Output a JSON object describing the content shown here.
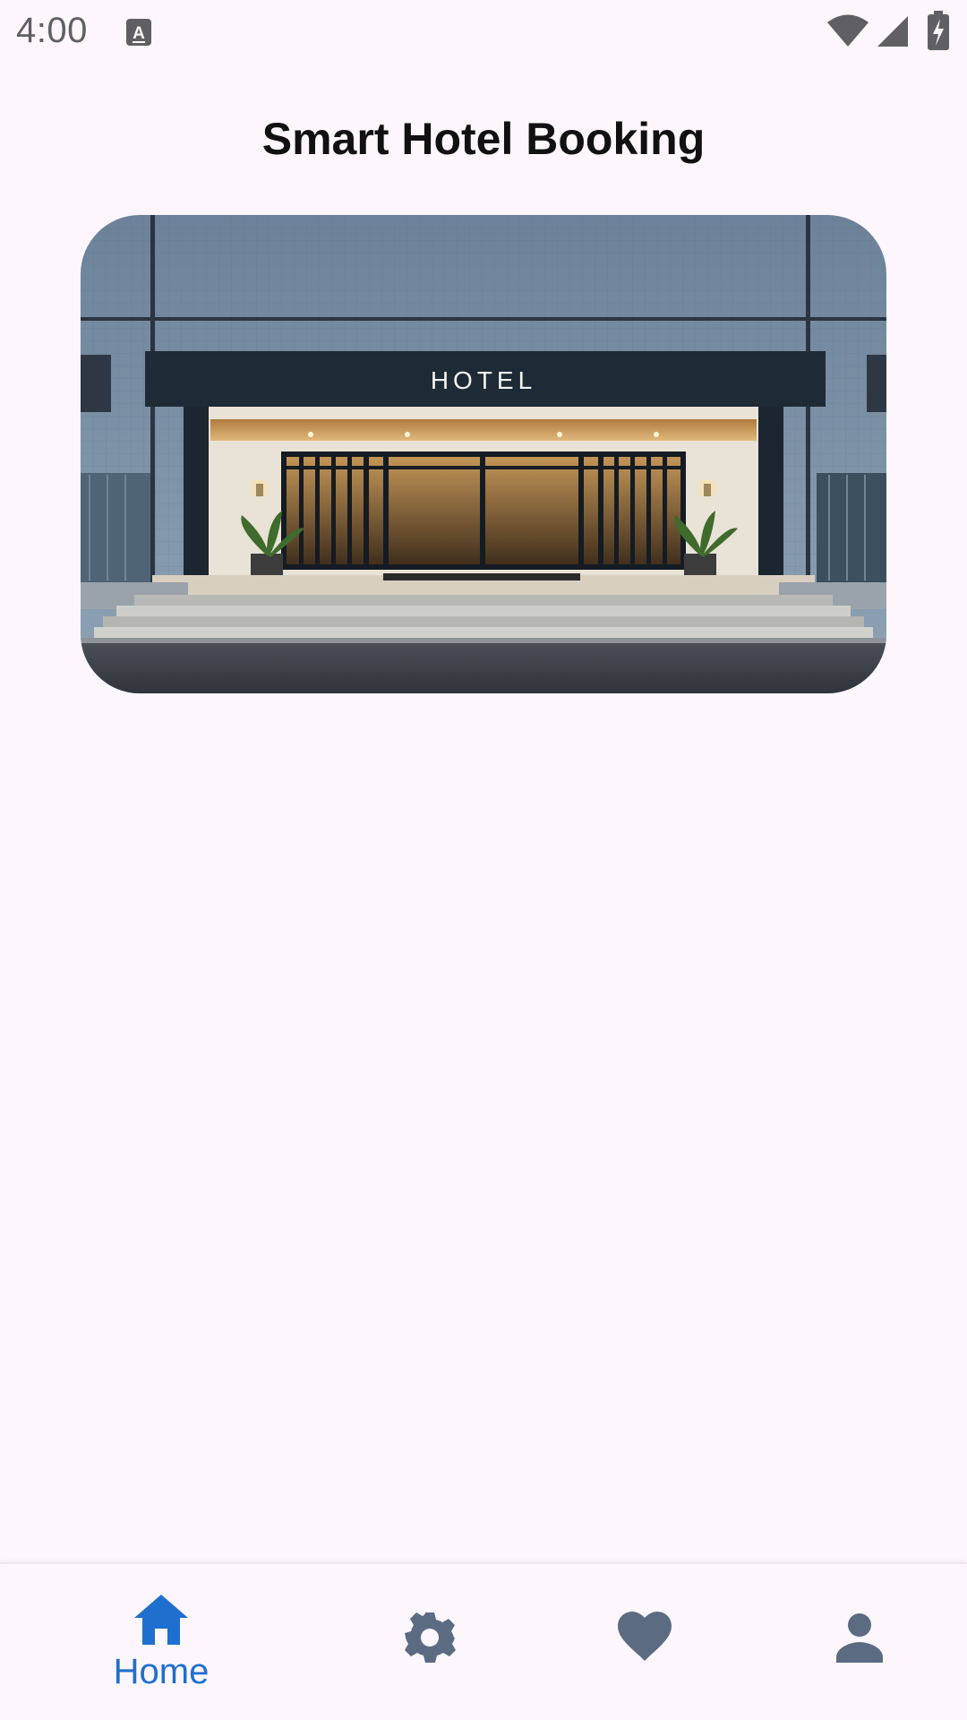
{
  "status_bar": {
    "time": "4:00",
    "icons": [
      "keyboard-a-icon",
      "wifi-icon",
      "signal-icon",
      "battery-charging-icon"
    ]
  },
  "header": {
    "title": "Smart Hotel Booking"
  },
  "hero": {
    "image": "hotel-entrance-photo",
    "sign_text": "HOTEL"
  },
  "bottom_nav": {
    "items": [
      {
        "icon": "home-icon",
        "label": "Home",
        "active": true
      },
      {
        "icon": "gear-icon",
        "label": "",
        "active": false
      },
      {
        "icon": "heart-icon",
        "label": "",
        "active": false
      },
      {
        "icon": "person-icon",
        "label": "",
        "active": false
      }
    ]
  },
  "colors": {
    "background": "#fdf6fc",
    "accent": "#1f6fcf",
    "inactive_icon": "#5b6b82",
    "title_text": "#111111"
  }
}
